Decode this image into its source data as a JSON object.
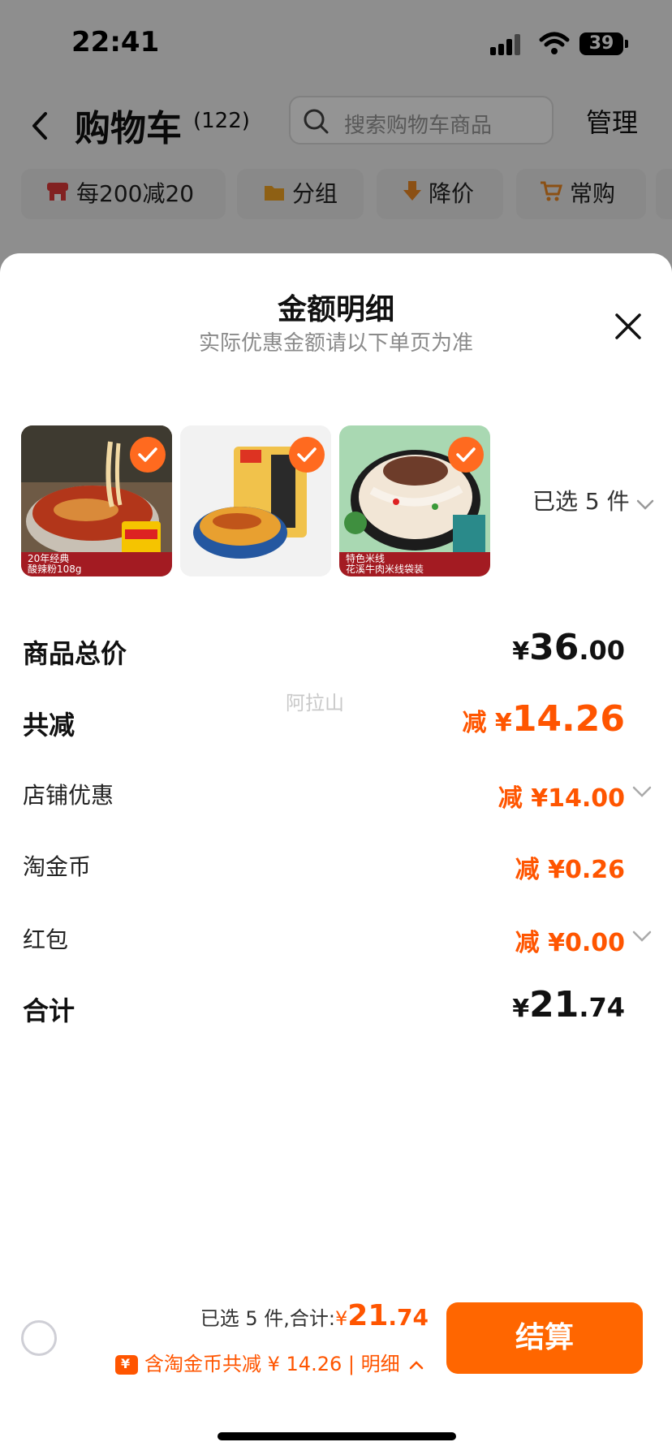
{
  "status_bar": {
    "time": "22:41",
    "battery": "39"
  },
  "nav": {
    "title": "购物车",
    "count": "(122)",
    "search_placeholder": "搜索购物车商品",
    "manage_label": "管理"
  },
  "chips": [
    {
      "label": "每200减20",
      "icon": "store-icon"
    },
    {
      "label": "分组",
      "icon": "folder-icon"
    },
    {
      "label": "降价",
      "icon": "arrow-down-icon"
    },
    {
      "label": "常购",
      "icon": "cart-icon"
    }
  ],
  "sheet": {
    "title": "金额明细",
    "subtitle": "实际优惠金额请以下单页为准",
    "selected_label": "已选 5 件",
    "thumb_tags": [
      [
        "20年经典",
        "酸辣粉108g"
      ],
      [],
      [
        "特色米线",
        "花溪牛肉米线袋装"
      ]
    ],
    "rows": {
      "total_label": "商品总价",
      "total_yen": "¥",
      "total_int": "36",
      "total_dec": ".00",
      "reduce_label": "共减",
      "reduce_prefix": "减 ¥",
      "reduce_value": "14.26",
      "shop_label": "店铺优惠",
      "shop_value": "减 ¥14.00",
      "coin_label": "淘金币",
      "coin_value": "减 ¥0.26",
      "redpacket_label": "红包",
      "redpacket_value": "减 ¥0.00",
      "sum_label": "合计",
      "sum_yen": "¥",
      "sum_int": "21",
      "sum_dec": ".74"
    },
    "watermark": "阿拉山"
  },
  "footer": {
    "selected_text": "已选 5 件,合计:",
    "yen": "¥",
    "amount_int": "21",
    "amount_dec": ".74",
    "reduce_text": "含淘金币共减 ¥ 14.26 | 明细",
    "checkout_label": "结算"
  },
  "colors": {
    "accent": "#ff5500",
    "button": "#ff6600",
    "tag": "#a31b22"
  }
}
